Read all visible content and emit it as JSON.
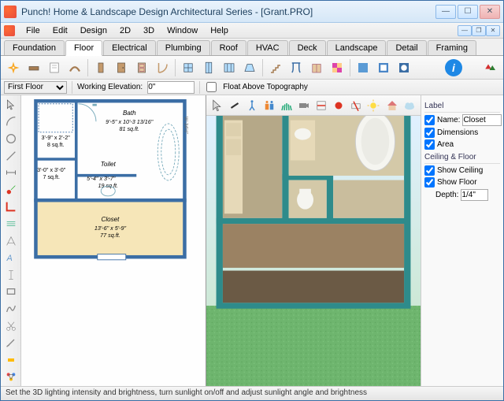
{
  "window": {
    "title": "Punch! Home & Landscape Design Architectural Series - [Grant.PRO]"
  },
  "menu": [
    "File",
    "Edit",
    "Design",
    "2D",
    "3D",
    "Window",
    "Help"
  ],
  "tabs": [
    {
      "label": "Foundation",
      "active": false
    },
    {
      "label": "Floor",
      "active": true
    },
    {
      "label": "Electrical",
      "active": false
    },
    {
      "label": "Plumbing",
      "active": false
    },
    {
      "label": "Roof",
      "active": false
    },
    {
      "label": "HVAC",
      "active": false
    },
    {
      "label": "Deck",
      "active": false
    },
    {
      "label": "Landscape",
      "active": false
    },
    {
      "label": "Detail",
      "active": false
    },
    {
      "label": "Framing",
      "active": false
    }
  ],
  "subbar": {
    "floor_select": "First Floor",
    "working_elev_label": "Working Elevation:",
    "working_elev_value": "0\"",
    "float_above": "Float Above Topography"
  },
  "plan": {
    "rooms": [
      {
        "name": "Bath",
        "dims": "9'-5\" x 10'-3 13/16\"",
        "area": "81 sq.ft."
      },
      {
        "name": "Toilet",
        "dims": "5'-4\" x 3'-7\"",
        "area": "19 sq.ft."
      },
      {
        "name": "Closet",
        "dims": "13'-6\" x 5'-9\"",
        "area": "77 sq.ft."
      }
    ],
    "small_spaces": [
      {
        "dims": "3'-9\" x 2'-2\"",
        "area": "8 sq.ft."
      },
      {
        "dims": "3'-0\" x 3'-0\"",
        "area": "7 sq.ft."
      }
    ],
    "ruler": "W-34½\""
  },
  "panel": {
    "label_hdr": "Label",
    "name_label": "Name:",
    "name_value": "Closet",
    "dimensions": "Dimensions",
    "area": "Area",
    "cf_hdr": "Ceiling & Floor",
    "show_ceiling": "Show Ceiling",
    "show_floor": "Show Floor",
    "depth_label": "Depth:",
    "depth_value": "1/4\""
  },
  "status": "Set the 3D lighting intensity and brightness, turn sunlight on/off and adjust sunlight angle and brightness"
}
